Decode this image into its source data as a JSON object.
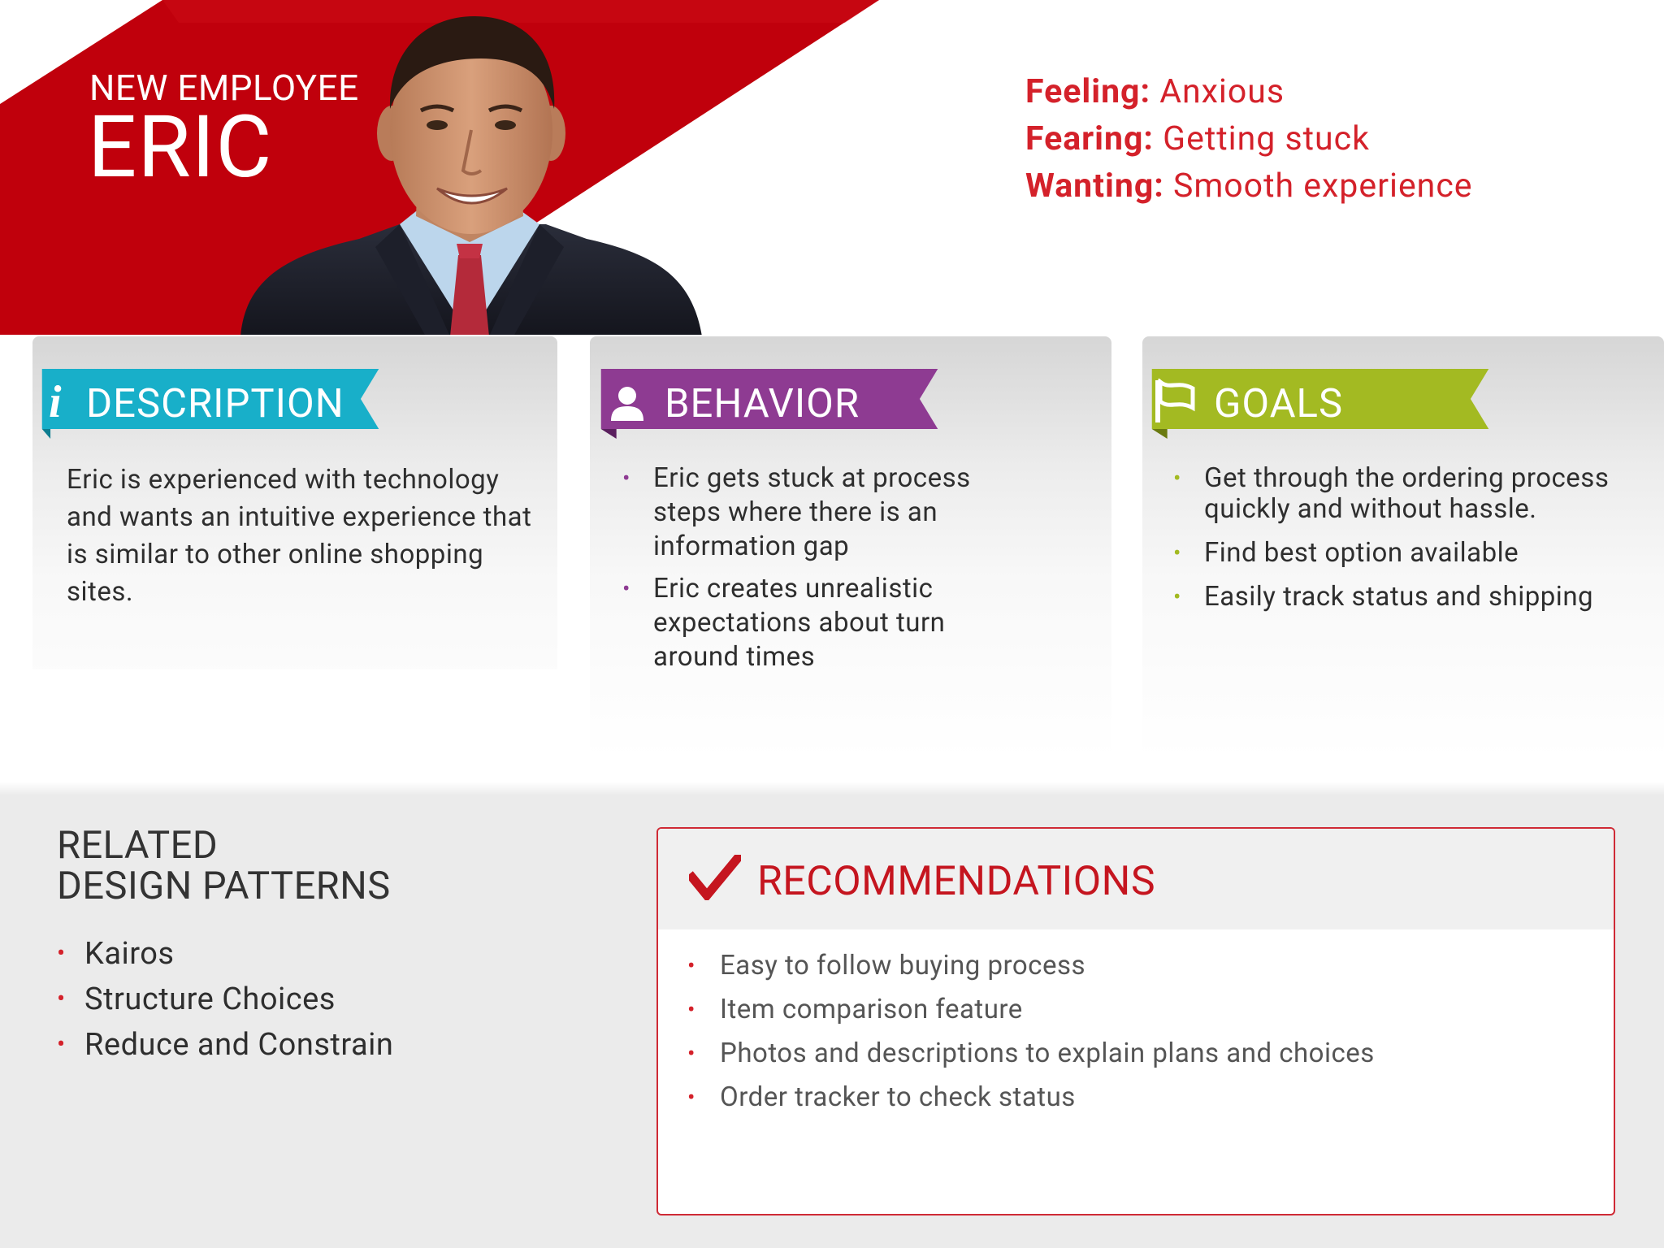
{
  "persona": {
    "role": "NEW EMPLOYEE",
    "name": "ERIC"
  },
  "emotions": [
    {
      "label": "Feeling:",
      "value": "Anxious"
    },
    {
      "label": "Fearing:",
      "value": "Getting stuck"
    },
    {
      "label": "Wanting:",
      "value": "Smooth experience"
    }
  ],
  "cards": {
    "description": {
      "title": "DESCRIPTION",
      "icon": "info-icon",
      "color": "#18afc9",
      "text": "Eric is experienced with technology and wants an intuitive experience that is similar to other online shopping sites."
    },
    "behavior": {
      "title": "BEHAVIOR",
      "icon": "user-icon",
      "color": "#8e3b92",
      "items": [
        "Eric gets stuck at process steps where there is an information gap",
        "Eric creates unrealistic expectations about turn around times"
      ]
    },
    "goals": {
      "title": "GOALS",
      "icon": "flag-icon",
      "color": "#a3ba22",
      "items": [
        "Get through the ordering process quickly and without hassle.",
        "Find best option available",
        "Easily track status and shipping"
      ]
    }
  },
  "related_patterns": {
    "title_line1": "RELATED",
    "title_line2": "DESIGN PATTERNS",
    "items": [
      "Kairos",
      "Structure Choices",
      "Reduce and Constrain"
    ]
  },
  "recommendations": {
    "title": "RECOMMENDATIONS",
    "icon": "checkmark-icon",
    "items": [
      "Easy to follow buying process",
      "Item comparison feature",
      "Photos and descriptions to explain plans and choices",
      "Order tracker to check status"
    ]
  },
  "colors": {
    "brand_red": "#d4212a",
    "banner_red": "#c0000c"
  }
}
